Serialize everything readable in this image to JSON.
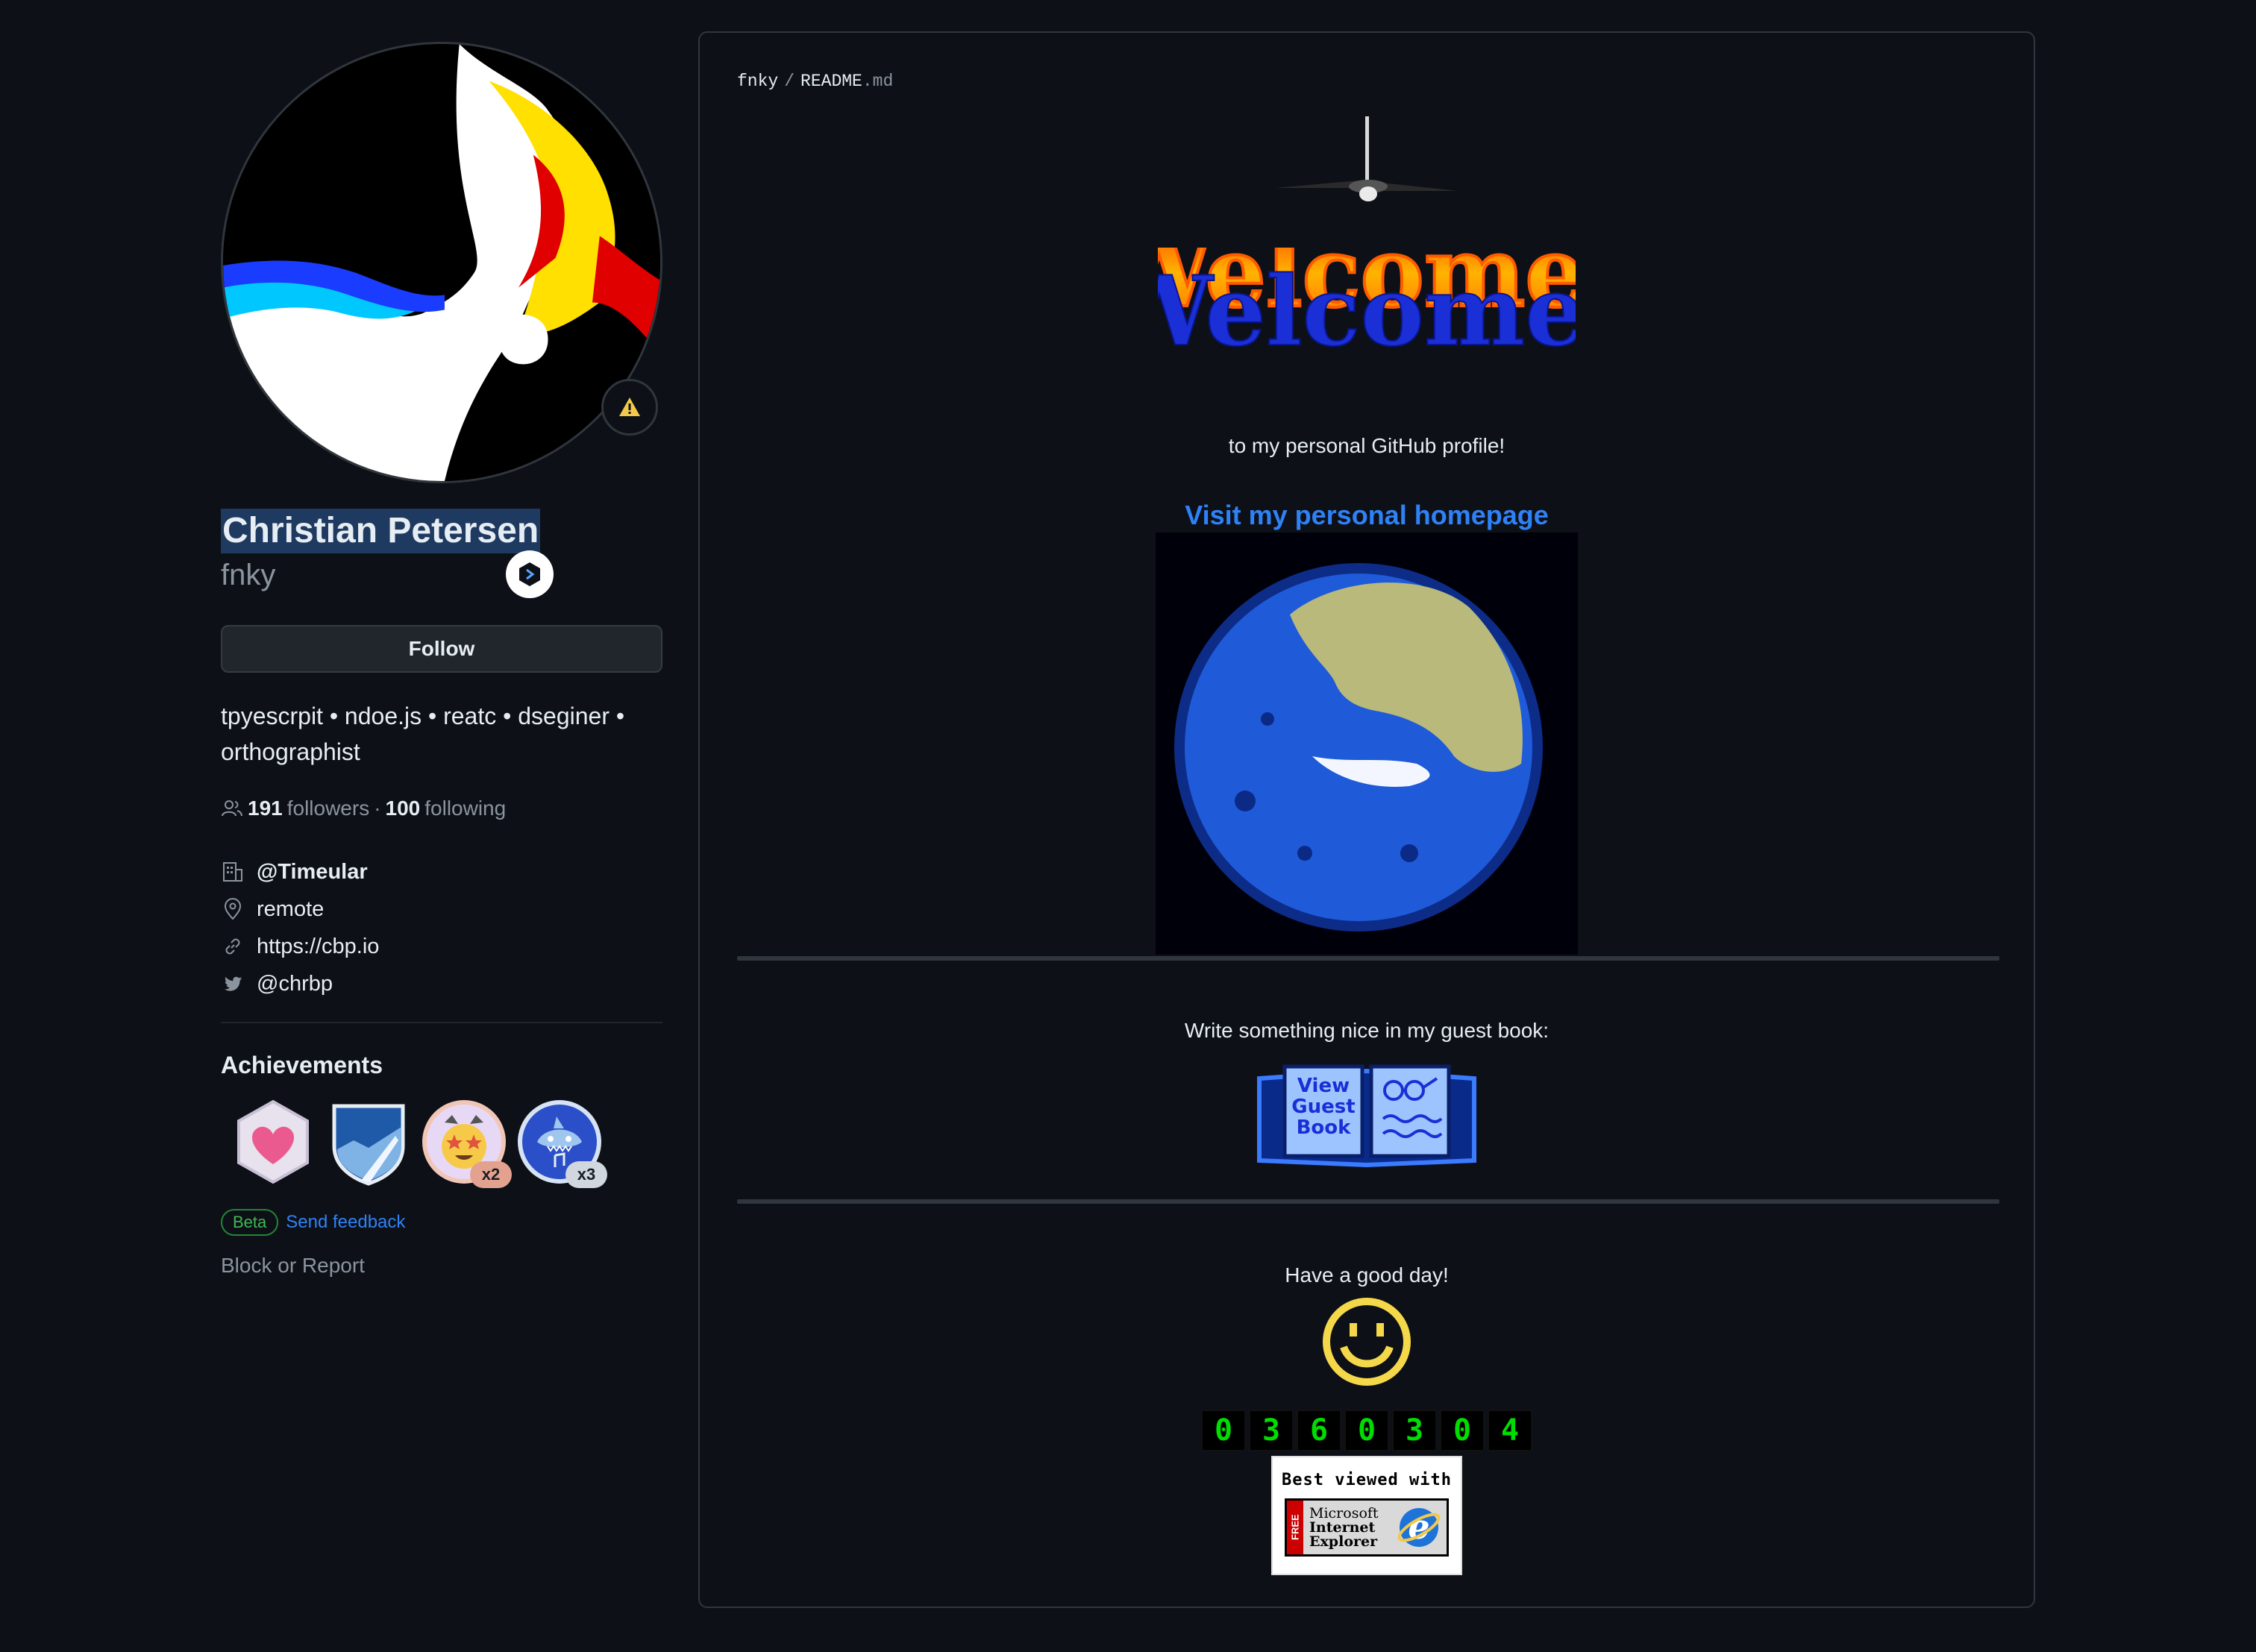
{
  "profile": {
    "name": "Christian Petersen",
    "username": "fnky",
    "follow_label": "Follow",
    "bio": "tpyescrpit • ndoe.js • reatc • dseginer • orthographist",
    "followers_count": "191",
    "followers_label": "followers",
    "separator": "·",
    "following_count": "100",
    "following_label": "following",
    "organization": "@Timeular",
    "location": "remote",
    "website": "https://cbp.io",
    "twitter": "@chrbp"
  },
  "achievements": {
    "title": "Achievements",
    "badges": [
      {
        "name": "heart-badge",
        "count": ""
      },
      {
        "name": "arctic-badge",
        "count": ""
      },
      {
        "name": "starstruck-badge",
        "count": "x2"
      },
      {
        "name": "shark-badge",
        "count": "x3"
      }
    ],
    "beta_label": "Beta",
    "feedback_label": "Send feedback"
  },
  "block_label": "Block or Report",
  "readme": {
    "breadcrumb_user": "fnky",
    "breadcrumb_sep": "/",
    "breadcrumb_file": "README",
    "breadcrumb_ext": ".md",
    "welcome_text": "Welcome!",
    "intro": "to my personal GitHub profile!",
    "homepage_link": "Visit my personal homepage",
    "guestbook_prompt": "Write something nice in my guest book:",
    "guestbook_view": "View",
    "guestbook_guest": "Guest",
    "guestbook_book": "Book",
    "goodbye": "Have a good day!",
    "counter_digits": [
      "0",
      "3",
      "6",
      "0",
      "3",
      "0",
      "4"
    ],
    "ie_badge_top": "Best viewed with",
    "ie_free": "FREE",
    "ie_line1": "Microsoft",
    "ie_line2": "Internet",
    "ie_line3": "Explorer"
  },
  "colors": {
    "background": "#0d1117",
    "link": "#2f81f7",
    "muted": "#8b949e",
    "counter_green": "#00dd00"
  }
}
